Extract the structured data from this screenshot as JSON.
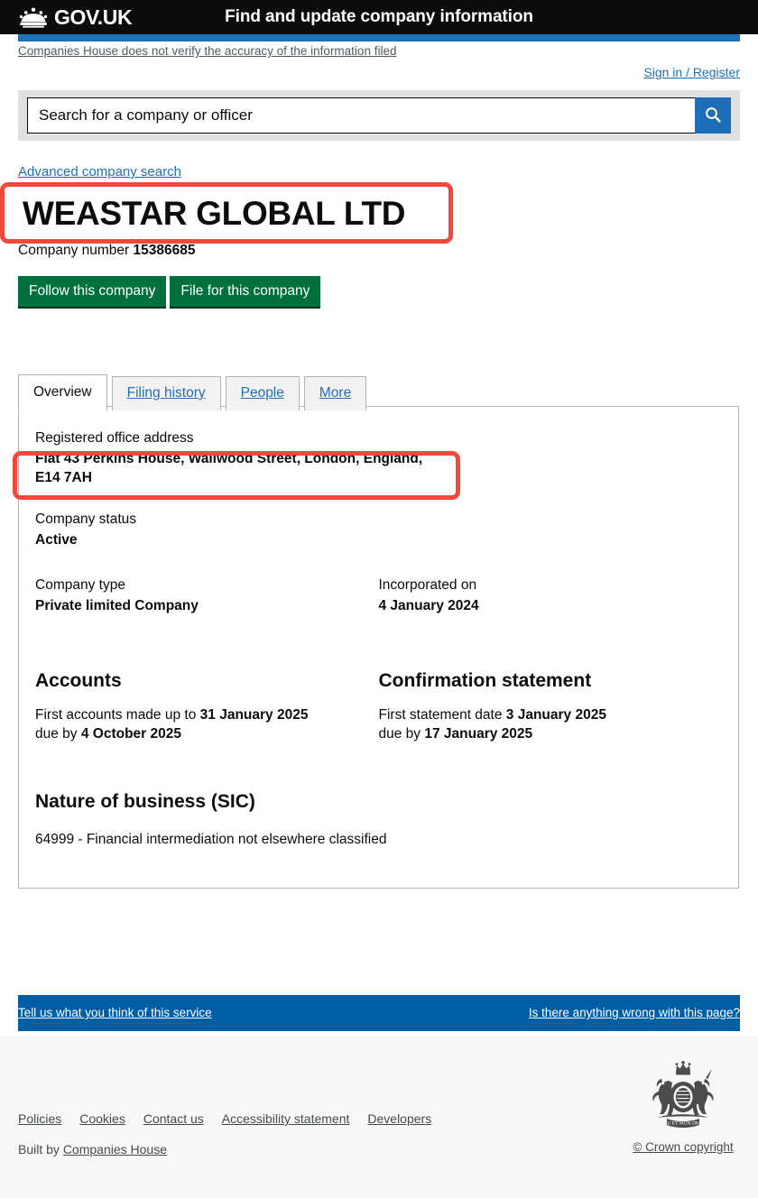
{
  "header": {
    "brand": "GOV.UK",
    "crown_icon": "crown-icon",
    "service_name": "Find and update company information"
  },
  "notice": {
    "text": "Companies House does not verify the accuracy of the information filed"
  },
  "account": {
    "sign_in_label": "Sign in / Register"
  },
  "search": {
    "placeholder": "Search for a company or officer",
    "value": "",
    "button_icon": "search-icon",
    "advanced_label": "Advanced company search"
  },
  "company": {
    "name": "WEASTAR GLOBAL LTD",
    "number_label": "Company number",
    "number": "15386685",
    "follow_button": "Follow this company",
    "file_button": "File for this company"
  },
  "tabs": [
    {
      "label": "Overview",
      "active": true
    },
    {
      "label": "Filing history",
      "active": false
    },
    {
      "label": "People",
      "active": false
    },
    {
      "label": "More",
      "active": false
    }
  ],
  "overview": {
    "address_label": "Registered office address",
    "address_value": "Flat 43 Perkins House, Wallwood Street, London, England, E14 7AH",
    "status_label": "Company status",
    "status_value": "Active",
    "type_label": "Company type",
    "type_value": "Private limited Company",
    "incorporated_label": "Incorporated on",
    "incorporated_value": "4 January 2024",
    "accounts": {
      "heading": "Accounts",
      "first_made_up_label": "First accounts made up to",
      "first_made_up_value": "31 January 2025",
      "due_by_label": "due by",
      "due_by_value": "4 October 2025"
    },
    "confirmation": {
      "heading": "Confirmation statement",
      "first_statement_label": "First statement date",
      "first_statement_value": "3 January 2025",
      "due_by_label": "due by",
      "due_by_value": "17 January 2025"
    },
    "sic": {
      "heading": "Nature of business (SIC)",
      "value": "64999 - Financial intermediation not elsewhere classified"
    }
  },
  "feedback": {
    "left_link": "Tell us what you think of this service",
    "right_link": "Is there anything wrong with this page?"
  },
  "footer": {
    "links": [
      "Policies",
      "Cookies",
      "Contact us",
      "Accessibility statement",
      "Developers"
    ],
    "built_by_prefix": "Built by",
    "built_by_link": "Companies House",
    "crest_icon": "royal-coat-of-arms-icon",
    "copyright": "© Crown copyright"
  },
  "colors": {
    "govuk_black": "#0b0c0c",
    "blue": "#1d70b8",
    "footer_blue": "#005ea5",
    "green": "#00703c",
    "highlight_red": "#f4483c",
    "grey_band": "#dee0e2"
  }
}
